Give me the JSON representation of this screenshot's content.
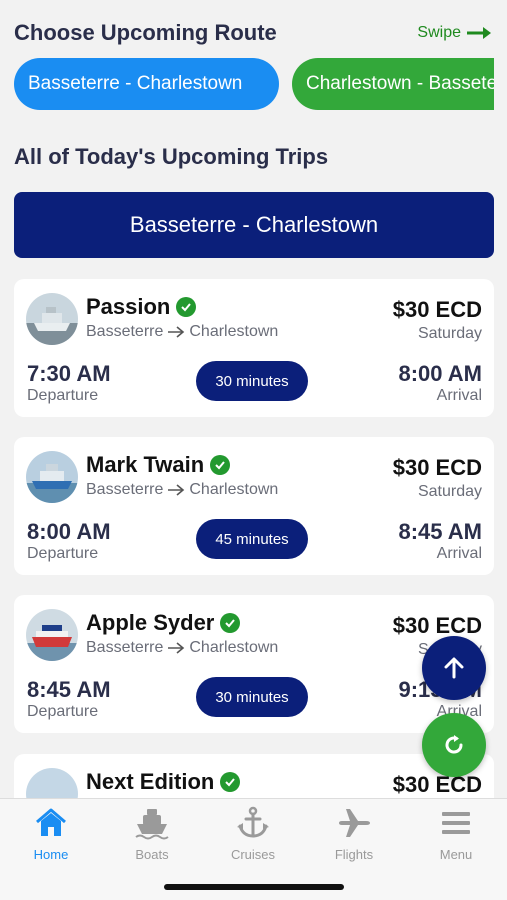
{
  "header": {
    "title": "Choose Upcoming Route",
    "swipe_label": "Swipe"
  },
  "routes": [
    {
      "label": "Basseterre - Charlestown",
      "color": "#1a8df2",
      "active": true
    },
    {
      "label": "Charlestown - Basseterre",
      "color": "#33a83a",
      "active": false
    }
  ],
  "trips_section": {
    "title": "All of Today's Upcoming Trips",
    "route_banner": "Basseterre - Charlestown"
  },
  "trips": [
    {
      "boat": "Passion",
      "from": "Basseterre",
      "to": "Charlestown",
      "price": "$30 ECD",
      "day": "Saturday",
      "departure_time": "7:30 AM",
      "departure_label": "Departure",
      "duration": "30 minutes",
      "arrival_time": "8:00 AM",
      "arrival_label": "Arrival"
    },
    {
      "boat": "Mark Twain",
      "from": "Basseterre",
      "to": "Charlestown",
      "price": "$30 ECD",
      "day": "Saturday",
      "departure_time": "8:00 AM",
      "departure_label": "Departure",
      "duration": "45 minutes",
      "arrival_time": "8:45 AM",
      "arrival_label": "Arrival"
    },
    {
      "boat": "Apple Syder",
      "from": "Basseterre",
      "to": "Charlestown",
      "price": "$30 ECD",
      "day": "Saturday",
      "departure_time": "8:45 AM",
      "departure_label": "Departure",
      "duration": "30 minutes",
      "arrival_time": "9:15 AM",
      "arrival_label": "Arrival"
    },
    {
      "boat": "Next Edition",
      "price": "$30 ECD"
    }
  ],
  "tabs": [
    {
      "label": "Home",
      "icon": "home-icon",
      "active": true
    },
    {
      "label": "Boats",
      "icon": "boat-icon",
      "active": false
    },
    {
      "label": "Cruises",
      "icon": "anchor-icon",
      "active": false
    },
    {
      "label": "Flights",
      "icon": "airplane-icon",
      "active": false
    },
    {
      "label": "Menu",
      "icon": "menu-icon",
      "active": false
    }
  ],
  "colors": {
    "primary_blue": "#1a8df2",
    "navy": "#0b1f7a",
    "green": "#33a83a",
    "verified_green": "#23992f"
  }
}
